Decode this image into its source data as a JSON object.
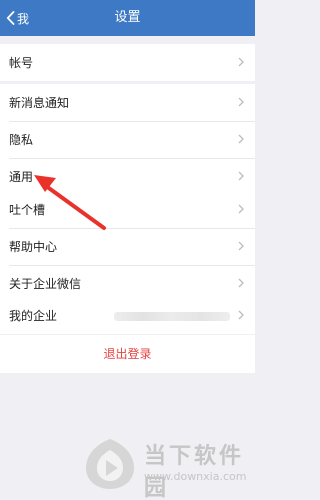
{
  "header": {
    "back_label": "我",
    "title": "设置"
  },
  "groups": [
    {
      "items": [
        {
          "label": "帐号"
        }
      ]
    },
    {
      "items": [
        {
          "label": "新消息通知"
        },
        {
          "label": "隐私"
        },
        {
          "label": "通用"
        }
      ]
    },
    {
      "items": [
        {
          "label": "吐个槽"
        },
        {
          "label": "帮助中心"
        },
        {
          "label": "关于企业微信"
        }
      ]
    },
    {
      "items": [
        {
          "label": "我的企业"
        }
      ]
    }
  ],
  "logout_label": "退出登录",
  "watermark": {
    "name": "当下软件园",
    "url": "www.downxia.com"
  },
  "colors": {
    "navbar": "#3d79c4",
    "background": "#efeff4",
    "logout": "#e64340",
    "annotation_arrow": "#e8322a"
  }
}
